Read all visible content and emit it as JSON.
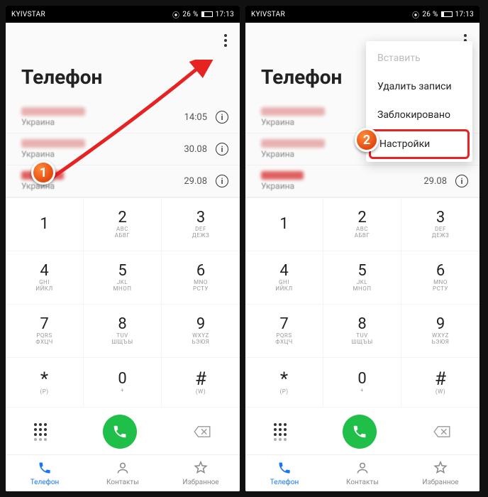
{
  "status": {
    "left": "KYIVSTAR",
    "recording": "26 %",
    "time": "17:13"
  },
  "title": "Телефон",
  "calls": [
    {
      "sub": "Украина",
      "time": "14:05",
      "red": false
    },
    {
      "sub": "Украина",
      "time": "30.08",
      "red": false
    },
    {
      "sub": "Украина",
      "time": "29.08",
      "red": true
    }
  ],
  "keys": [
    {
      "d": "1",
      "l1": "",
      "l2": ""
    },
    {
      "d": "2",
      "l1": "ABC",
      "l2": "АБВГ"
    },
    {
      "d": "3",
      "l1": "DEF",
      "l2": "ДЕЖЗ"
    },
    {
      "d": "4",
      "l1": "GHI",
      "l2": "ИЙКЛ"
    },
    {
      "d": "5",
      "l1": "JKL",
      "l2": "МНОП"
    },
    {
      "d": "6",
      "l1": "MNO",
      "l2": "РСТУ"
    },
    {
      "d": "7",
      "l1": "PQRS",
      "l2": "ФХЦЧ"
    },
    {
      "d": "8",
      "l1": "TUV",
      "l2": "ШЩЪЫ"
    },
    {
      "d": "9",
      "l1": "WXYZ",
      "l2": "ЬЭЮЯ"
    },
    {
      "d": "*",
      "l1": "(P)",
      "l2": "",
      "big": true
    },
    {
      "d": "0",
      "l1": "+",
      "l2": ""
    },
    {
      "d": "#",
      "l1": "(W)",
      "l2": "",
      "big": true
    }
  ],
  "nav": [
    {
      "label": "Телефон",
      "active": true,
      "icon": "phone"
    },
    {
      "label": "Контакты",
      "active": false,
      "icon": "contacts"
    },
    {
      "label": "Избранное",
      "active": false,
      "icon": "star"
    }
  ],
  "menu": {
    "paste": "Вставить",
    "delete": "Удалить записи",
    "blocked": "Заблокировано",
    "settings": "Настройки"
  },
  "badges": {
    "one": "1",
    "two": "2"
  }
}
